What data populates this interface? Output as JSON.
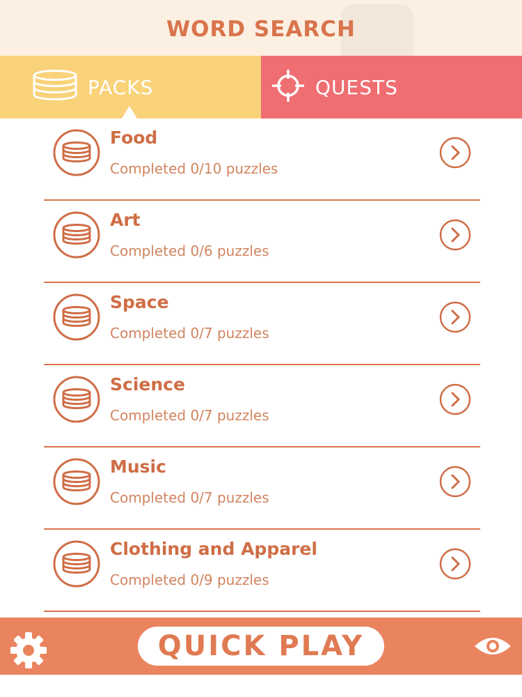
{
  "app": {
    "title": "WORD SEARCH"
  },
  "tabs": [
    {
      "label": "PACKS",
      "icon": "coin-stack-icon",
      "selected": true,
      "color": "#f9d27a"
    },
    {
      "label": "QUESTS",
      "icon": "crosshair-icon",
      "selected": false,
      "color": "#ef6e72"
    }
  ],
  "packs": [
    {
      "name": "Food",
      "progress": "Completed 0/10 puzzles"
    },
    {
      "name": "Art",
      "progress": "Completed 0/6 puzzles"
    },
    {
      "name": "Space",
      "progress": "Completed 0/7 puzzles"
    },
    {
      "name": "Science",
      "progress": "Completed 0/7 puzzles"
    },
    {
      "name": "Music",
      "progress": "Completed 0/7 puzzles"
    },
    {
      "name": "Clothing and Apparel",
      "progress": "Completed 0/9 puzzles"
    }
  ],
  "footer": {
    "quick_play_label": "QUICK PLAY",
    "left_icon": "gear-icon",
    "right_icon": "eye-icon"
  },
  "colors": {
    "accent": "#d9744c",
    "header_bg": "#fbf0e2",
    "footer_bg": "#ea845e"
  }
}
